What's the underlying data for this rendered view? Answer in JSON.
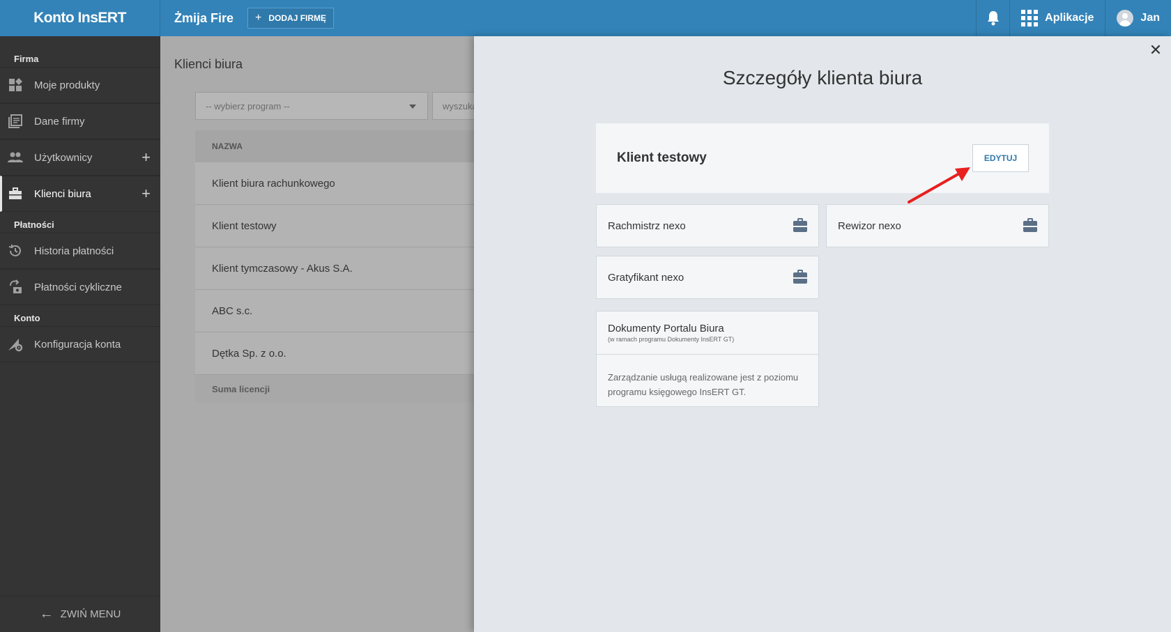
{
  "topbar": {
    "brand": "Konto InsERT",
    "company": "Żmija Fire",
    "add_company_label": "DODAJ FIRMĘ",
    "apps_label": "Aplikacje",
    "user_name": "Jan"
  },
  "sidebar": {
    "sections": [
      {
        "title": "Firma"
      },
      {
        "title": "Płatności"
      },
      {
        "title": "Konto"
      }
    ],
    "items": [
      {
        "label": "Moje produkty",
        "icon": "widgets-icon"
      },
      {
        "label": "Dane firmy",
        "icon": "document-icon"
      },
      {
        "label": "Użytkownicy",
        "icon": "users-icon"
      },
      {
        "label": "Klienci biura",
        "icon": "briefcase-icon"
      },
      {
        "label": "Historia płatności",
        "icon": "history-icon"
      },
      {
        "label": "Płatności cykliczne",
        "icon": "recurring-icon"
      },
      {
        "label": "Konfiguracja konta",
        "icon": "settings-icon"
      }
    ],
    "collapse_label": "ZWIŃ MENU"
  },
  "background_page": {
    "title": "Klienci biura",
    "select_placeholder": "-- wybierz program --",
    "search_placeholder": "wyszuka",
    "column_header": "NAZWA",
    "rows": [
      "Klient biura rachunkowego",
      "Klient testowy",
      "Klient tymczasowy - Akus S.A.",
      "ABC s.c.",
      "Dętka Sp. z o.o."
    ],
    "footer": "Suma licencji"
  },
  "panel": {
    "title": "Szczegóły klienta biura",
    "client_name": "Klient testowy",
    "edit_label": "EDYTUJ",
    "products": [
      {
        "name": "Rachmistrz nexo"
      },
      {
        "name": "Rewizor nexo"
      },
      {
        "name": "Gratyfikant nexo"
      }
    ],
    "doc": {
      "title": "Dokumenty Portalu Biura",
      "subtitle": "(w ramach programu Dokumenty InsERT GT)",
      "body": "Zarządzanie usługą realizowane jest z poziomu programu księgowego InsERT GT."
    }
  },
  "colors": {
    "topbar": "#3383b8",
    "sidebar": "#343434",
    "panel": "#e3e7eb",
    "arrow": "#e8201f"
  }
}
